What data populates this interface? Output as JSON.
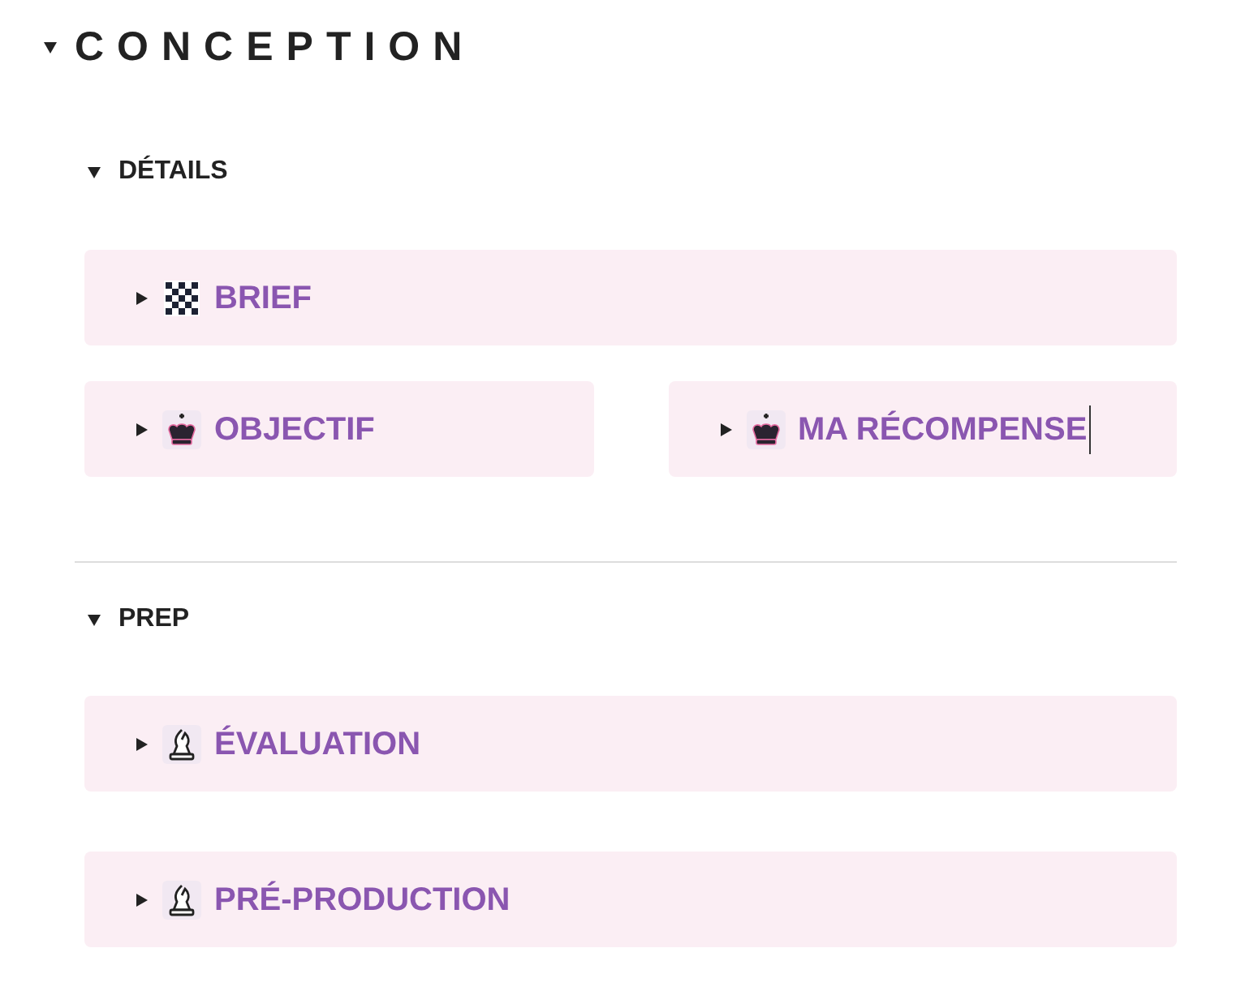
{
  "heading": {
    "title": "CONCEPTION",
    "expanded": true
  },
  "sections": [
    {
      "title": "DÉTAILS",
      "expanded": true,
      "rows": [
        [
          {
            "label": "BRIEF",
            "kind": "checker",
            "expanded": false,
            "focused": false
          }
        ],
        [
          {
            "label": "OBJECTIF",
            "kind": "king",
            "expanded": false,
            "focused": false
          },
          {
            "label": "MA RÉCOMPENSE",
            "kind": "king",
            "expanded": false,
            "focused": true
          }
        ]
      ]
    },
    {
      "title": "PREP",
      "expanded": true,
      "rows": [
        [
          {
            "label": "ÉVALUATION",
            "kind": "bishop",
            "expanded": false,
            "focused": false
          }
        ],
        [
          {
            "label": "PRÉ-PRODUCTION",
            "kind": "bishop",
            "expanded": false,
            "focused": false
          }
        ]
      ]
    }
  ]
}
